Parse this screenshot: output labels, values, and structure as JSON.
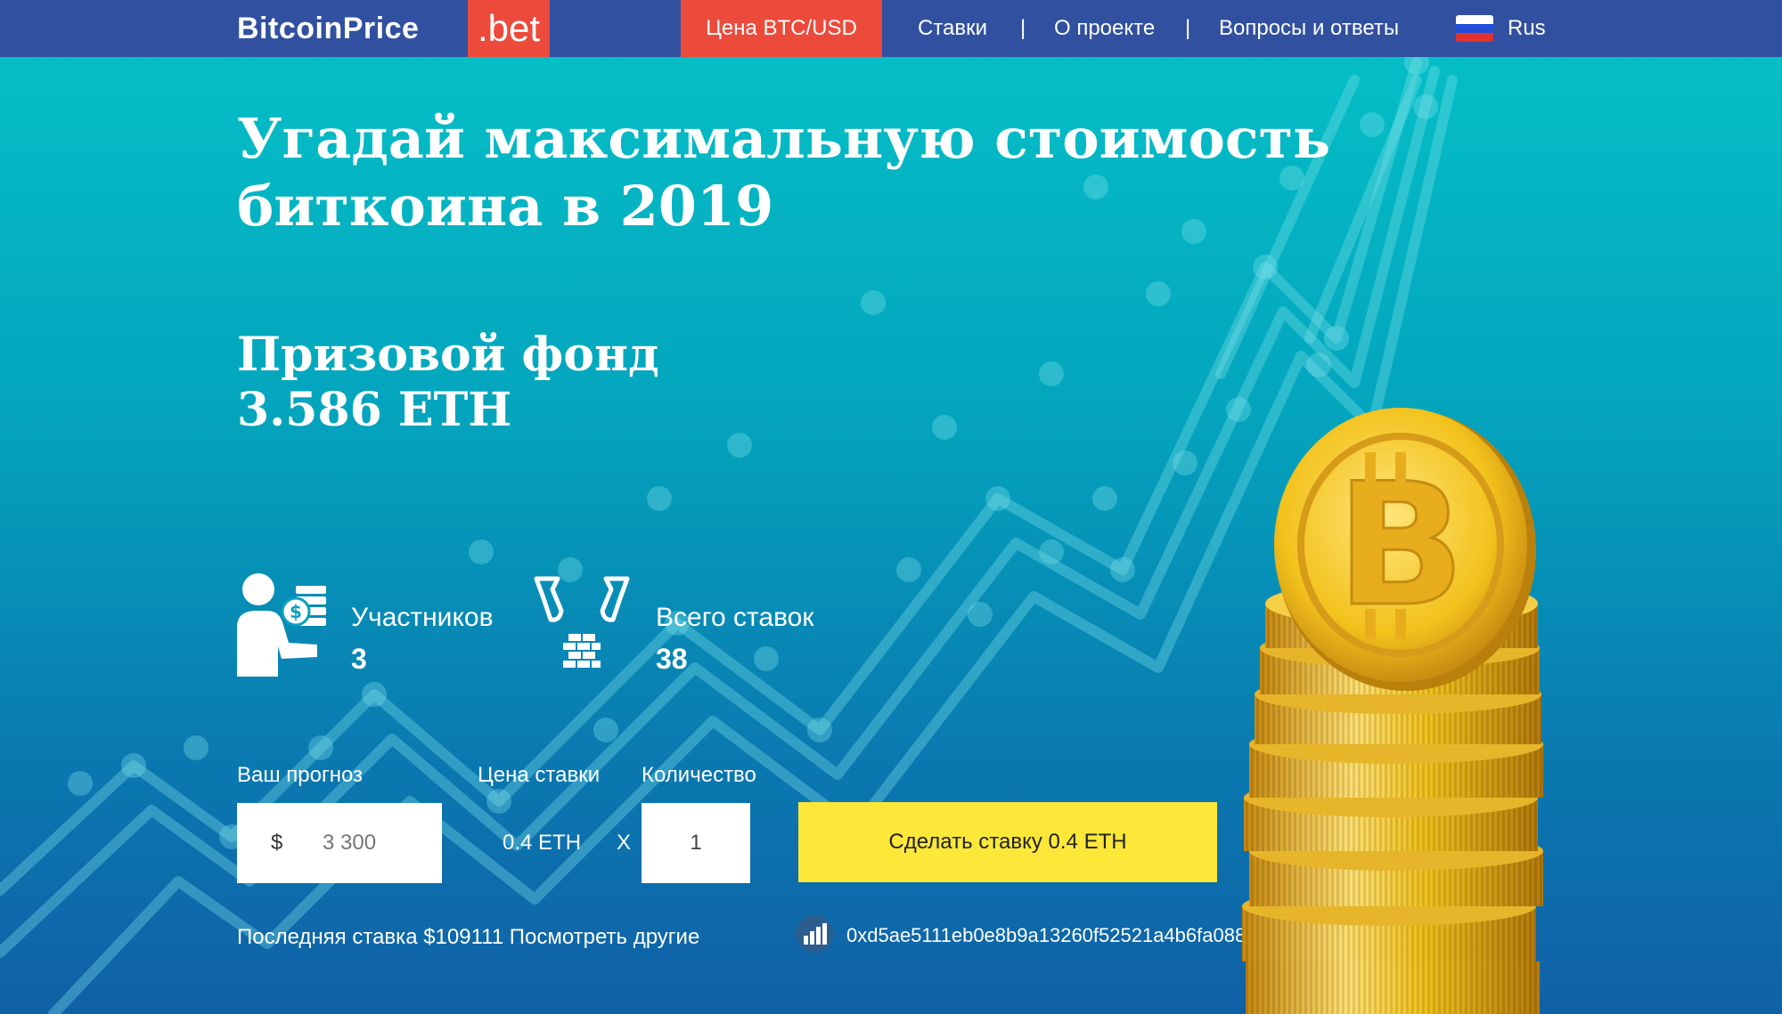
{
  "nav": {
    "logo_text": "BitcoinPrice",
    "logo_suffix": ".bet",
    "active_item": "Цена BTC/USD",
    "items": [
      "Ставки",
      "О проекте",
      "Вопросы и ответы"
    ],
    "separator": "|",
    "language": "Rus",
    "flag_icon": "russia-flag-icon"
  },
  "hero": {
    "title": "Угадай максимальную стоимость биткоина в 2019",
    "prize_label": "Призовой фонд",
    "prize_value": "3.586 ETH"
  },
  "stats": {
    "participants_label": "Участников",
    "participants_value": "3",
    "participants_icon": "person-coins-icon",
    "bets_label": "Всего ставок",
    "bets_value": "38",
    "bets_icon": "hands-bricks-icon"
  },
  "form": {
    "prediction_label": "Ваш прогноз",
    "currency_symbol": "$",
    "prediction_placeholder": "3 300",
    "price_label": "Цена ставки",
    "price_value": "0.4 ETH",
    "multiply_sign": "X",
    "quantity_label": "Количество",
    "quantity_value": "1",
    "submit_label": "Сделать ставку 0.4 ETH"
  },
  "last_bet": {
    "text": "Последняя ставка $109111",
    "link": "Посмотреть другие",
    "wallet_icon": "chart-avatar-icon",
    "wallet_address": "0xd5ae5111eb0e8b9a13260f52521a4b6fa0880fec"
  },
  "colors": {
    "nav_bg": "#3150a0",
    "accent_red": "#ec4b3c",
    "button_yellow": "#fde83a",
    "coin_gold": "#f2c21c"
  }
}
